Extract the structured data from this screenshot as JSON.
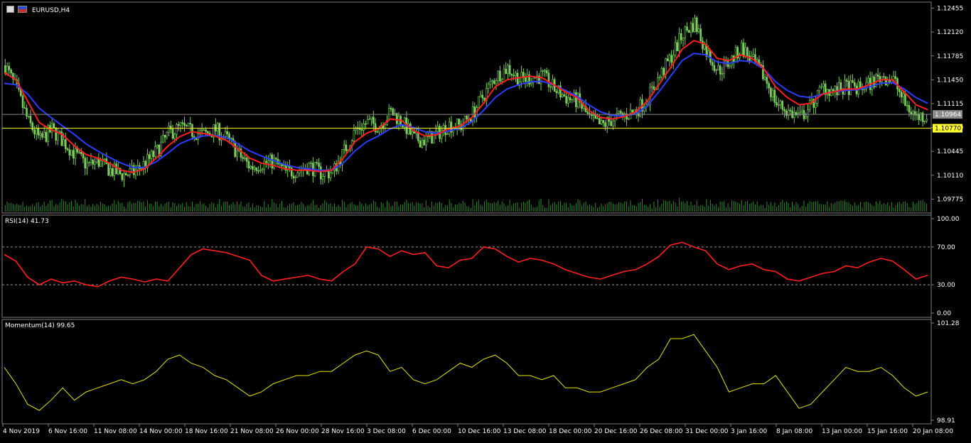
{
  "symbol_title": "EURUSD,H4",
  "colors": {
    "background": "#000000",
    "panel_border": "#7f7f7f",
    "candle": "#7bd05a",
    "ma_fast": "#ff1f1f",
    "ma_slow": "#2b3cff",
    "rsi": "#ff1f1f",
    "momentum": "#e6e600",
    "volume": "#2e8b2e",
    "bid_line": "#8a8a8a",
    "ask_line": "#ffff33"
  },
  "icons": [
    "chart-symbol-icon",
    "flag-icon"
  ],
  "price_labels": {
    "current": "1.10964",
    "ask": "1.10770"
  },
  "x_axis_labels": [
    "4 Nov 2019",
    "6 Nov 16:00",
    "11 Nov 08:00",
    "14 Nov 00:00",
    "18 Nov 16:00",
    "21 Nov 08:00",
    "26 Nov 00:00",
    "28 Nov 16:00",
    "3 Dec 08:00",
    "6 Dec 00:00",
    "10 Dec 16:00",
    "13 Dec 08:00",
    "18 Dec 00:00",
    "20 Dec 16:00",
    "26 Dec 08:00",
    "31 Dec 00:00",
    "3 Jan 16:00",
    "8 Jan 08:00",
    "13 Jan 00:00",
    "15 Jan 16:00",
    "20 Jan 08:00"
  ],
  "chart_data": [
    {
      "type": "line",
      "title": "EURUSD,H4",
      "ylim": [
        1.096,
        1.1253
      ],
      "y_ticks": [
        "1.12455",
        "1.12120",
        "1.11785",
        "1.11450",
        "1.11115",
        "1.10780",
        "1.10445",
        "1.10110",
        "1.09775"
      ],
      "series": [
        {
          "role": "price",
          "values": [
            1.1165,
            1.113,
            1.1085,
            1.106,
            1.1075,
            1.1058,
            1.104,
            1.1025,
            1.103,
            1.1018,
            1.1012,
            1.1015,
            1.1028,
            1.1045,
            1.107,
            1.1078,
            1.1072,
            1.1068,
            1.1075,
            1.1062,
            1.104,
            1.1022,
            1.1028,
            1.103,
            1.1015,
            1.1018,
            1.1024,
            1.1014,
            1.1015,
            1.1045,
            1.1075,
            1.1085,
            1.108,
            1.11,
            1.1085,
            1.1062,
            1.106,
            1.107,
            1.1082,
            1.108,
            1.1098,
            1.1125,
            1.115,
            1.1162,
            1.1145,
            1.1148,
            1.115,
            1.1132,
            1.112,
            1.1115,
            1.109,
            1.108,
            1.109,
            1.1095,
            1.1102,
            1.112,
            1.115,
            1.1178,
            1.121,
            1.1225,
            1.1185,
            1.1158,
            1.117,
            1.119,
            1.117,
            1.1148,
            1.1112,
            1.11,
            1.1092,
            1.111,
            1.1135,
            1.1128,
            1.1135,
            1.1132,
            1.114,
            1.115,
            1.1145,
            1.111,
            1.1093,
            1.1095
          ]
        },
        {
          "role": "ma_fast",
          "values": [
            1.1155,
            1.1145,
            1.1115,
            1.1085,
            1.1075,
            1.1068,
            1.1052,
            1.104,
            1.1035,
            1.1028,
            1.1018,
            1.1015,
            1.102,
            1.1035,
            1.1052,
            1.1065,
            1.1072,
            1.107,
            1.1066,
            1.106,
            1.1048,
            1.1035,
            1.1028,
            1.1025,
            1.102,
            1.1018,
            1.1018,
            1.1016,
            1.1018,
            1.1035,
            1.1058,
            1.107,
            1.1076,
            1.109,
            1.1088,
            1.1074,
            1.1066,
            1.1068,
            1.1076,
            1.108,
            1.1092,
            1.1112,
            1.1135,
            1.1145,
            1.1148,
            1.115,
            1.1148,
            1.1138,
            1.1128,
            1.112,
            1.1102,
            1.1092,
            1.109,
            1.1093,
            1.11,
            1.1115,
            1.1138,
            1.1162,
            1.1188,
            1.12,
            1.1195,
            1.1175,
            1.1172,
            1.118,
            1.1175,
            1.116,
            1.1135,
            1.112,
            1.111,
            1.1112,
            1.1125,
            1.1128,
            1.1132,
            1.1132,
            1.1138,
            1.1145,
            1.1145,
            1.1128,
            1.111,
            1.1103
          ]
        },
        {
          "role": "ma_slow",
          "values": [
            1.114,
            1.1138,
            1.1125,
            1.1105,
            1.1092,
            1.108,
            1.1068,
            1.1055,
            1.1045,
            1.1036,
            1.1028,
            1.1022,
            1.1022,
            1.103,
            1.1042,
            1.1055,
            1.1062,
            1.1066,
            1.1067,
            1.1064,
            1.1055,
            1.1045,
            1.1038,
            1.1032,
            1.1026,
            1.1022,
            1.102,
            1.1018,
            1.1018,
            1.1028,
            1.1045,
            1.1058,
            1.1066,
            1.1076,
            1.1082,
            1.1078,
            1.1072,
            1.107,
            1.1073,
            1.1077,
            1.1086,
            1.1102,
            1.112,
            1.1132,
            1.1138,
            1.1142,
            1.1143,
            1.1138,
            1.113,
            1.1122,
            1.111,
            1.11,
            1.1095,
            1.1094,
            1.1097,
            1.1108,
            1.1128,
            1.115,
            1.1172,
            1.1182,
            1.118,
            1.117,
            1.1168,
            1.1172,
            1.117,
            1.116,
            1.1142,
            1.113,
            1.1122,
            1.112,
            1.1125,
            1.1128,
            1.113,
            1.1131,
            1.1135,
            1.114,
            1.1141,
            1.1132,
            1.112,
            1.1112
          ]
        }
      ]
    },
    {
      "type": "line",
      "title": "RSI(14) 41.73",
      "ylim": [
        0,
        100
      ],
      "y_ticks": [
        "100.00",
        "70.00",
        "30.00",
        "0.00"
      ],
      "levels": [
        70,
        30
      ],
      "series": [
        {
          "role": "rsi",
          "values": [
            62,
            55,
            38,
            30,
            36,
            32,
            34,
            30,
            28,
            34,
            38,
            36,
            33,
            36,
            34,
            48,
            62,
            68,
            66,
            64,
            60,
            56,
            40,
            34,
            36,
            38,
            40,
            36,
            34,
            44,
            52,
            70,
            68,
            60,
            66,
            62,
            64,
            50,
            48,
            56,
            58,
            70,
            68,
            60,
            54,
            58,
            56,
            52,
            46,
            42,
            38,
            36,
            40,
            44,
            46,
            52,
            60,
            72,
            75,
            70,
            66,
            52,
            46,
            50,
            52,
            46,
            44,
            36,
            34,
            38,
            42,
            44,
            50,
            48,
            54,
            58,
            55,
            46,
            36,
            40
          ]
        }
      ]
    },
    {
      "type": "line",
      "title": "Momentum(14) 99.65",
      "ylim": [
        98.91,
        101.28
      ],
      "y_ticks": [
        "101.28",
        "98.91"
      ],
      "series": [
        {
          "role": "momentum",
          "values": [
            100.2,
            99.8,
            99.3,
            99.15,
            99.4,
            99.7,
            99.4,
            99.6,
            99.7,
            99.8,
            99.9,
            99.8,
            99.9,
            100.1,
            100.4,
            100.5,
            100.3,
            100.2,
            100.0,
            99.9,
            99.7,
            99.5,
            99.6,
            99.8,
            99.9,
            100.0,
            100.0,
            100.1,
            100.1,
            100.3,
            100.5,
            100.6,
            100.5,
            100.1,
            100.2,
            99.9,
            99.8,
            99.9,
            100.1,
            100.3,
            100.2,
            100.4,
            100.5,
            100.3,
            100.0,
            100.0,
            99.9,
            100.0,
            99.7,
            99.7,
            99.6,
            99.6,
            99.7,
            99.8,
            99.9,
            100.2,
            100.4,
            100.9,
            100.9,
            101.0,
            100.6,
            100.2,
            99.6,
            99.7,
            99.8,
            99.8,
            100.0,
            99.6,
            99.2,
            99.3,
            99.6,
            99.9,
            100.2,
            100.1,
            100.1,
            100.2,
            100.0,
            99.7,
            99.5,
            99.6
          ]
        }
      ]
    }
  ]
}
